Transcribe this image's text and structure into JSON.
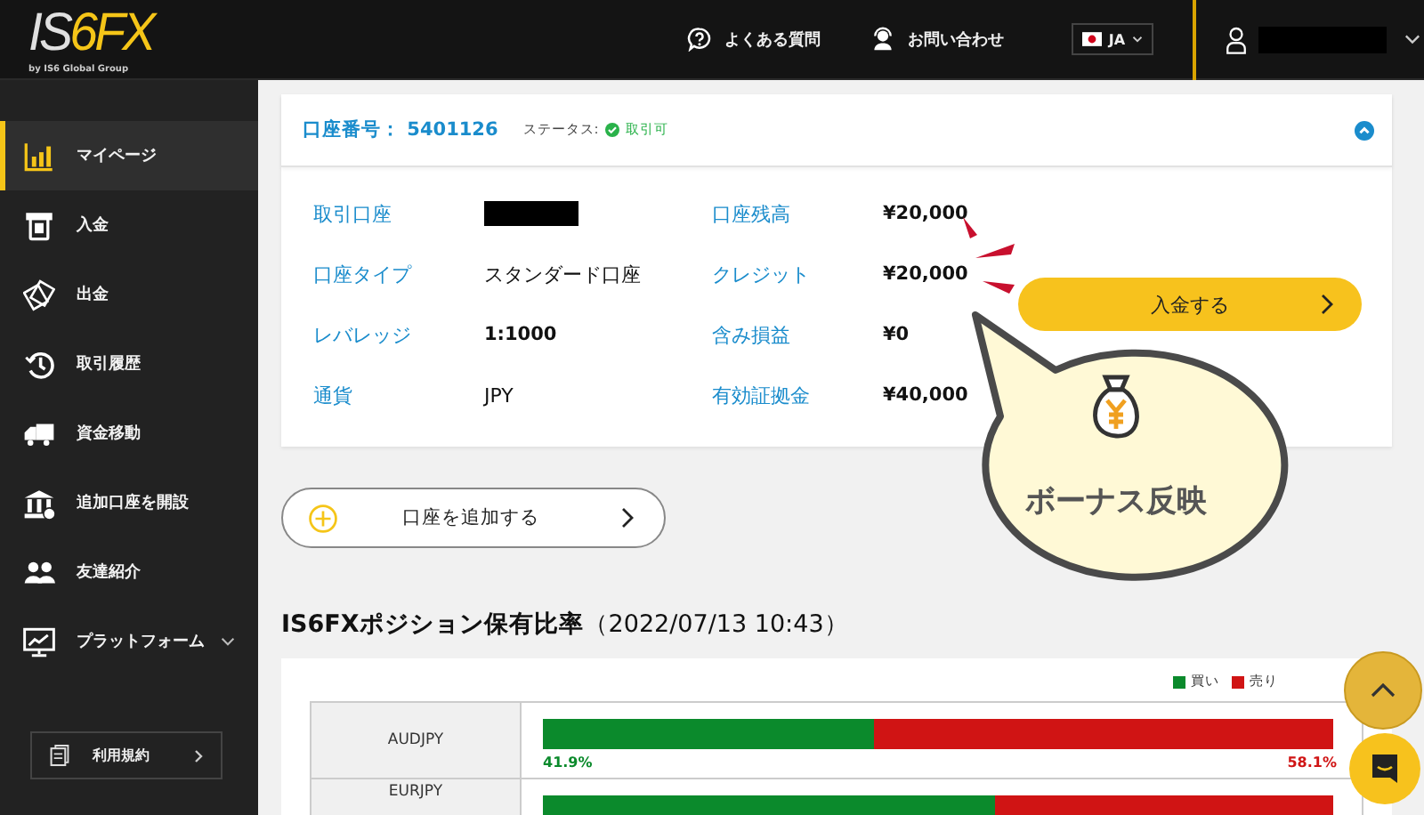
{
  "header": {
    "logo_main": "IS",
    "logo_accent": "6FX",
    "logo_tagline": "by IS6 Global Group",
    "links": [
      {
        "kind": "help",
        "label": "よくある質問"
      },
      {
        "kind": "contact",
        "label": "お問い合わせ"
      }
    ],
    "language": "JA"
  },
  "sidebar": {
    "items": [
      {
        "kind": "chart",
        "label": "マイページ",
        "selected": true,
        "expandable": false
      },
      {
        "kind": "deposit",
        "label": "入金",
        "selected": false,
        "expandable": false
      },
      {
        "kind": "withdraw",
        "label": "出金",
        "selected": false,
        "expandable": false
      },
      {
        "kind": "history",
        "label": "取引履歴",
        "selected": false,
        "expandable": false
      },
      {
        "kind": "transfer",
        "label": "資金移動",
        "selected": false,
        "expandable": false
      },
      {
        "kind": "bank",
        "label": "追加口座を開設",
        "selected": false,
        "expandable": false
      },
      {
        "kind": "friends",
        "label": "友達紹介",
        "selected": false,
        "expandable": false
      },
      {
        "kind": "monitor",
        "label": "プラットフォーム",
        "selected": false,
        "expandable": true
      }
    ],
    "terms_button": "利用規約"
  },
  "account": {
    "number_label": "口座番号：",
    "number": "5401126",
    "status_label": "ステータス:",
    "status": "取引可",
    "expanded": true,
    "fields": [
      {
        "label": "取引口座",
        "kind": "redacted"
      },
      {
        "label": "口座残高",
        "kind": "bold",
        "value": "¥20,000"
      },
      {
        "label": "口座タイプ",
        "kind": "text",
        "value": "スタンダード口座"
      },
      {
        "label": "クレジット",
        "kind": "bold",
        "value": "¥20,000"
      },
      {
        "label": "レバレッジ",
        "kind": "bold",
        "value": "1:1000"
      },
      {
        "label": "含み損益",
        "kind": "bold",
        "value": "¥0"
      },
      {
        "label": "通貨",
        "kind": "text",
        "value": "JPY"
      },
      {
        "label": "有効証拠金",
        "kind": "bold",
        "value": "¥40,000"
      }
    ],
    "deposit_button": "入金する"
  },
  "callout": "ボーナス反映",
  "add_account_button": "口座を追加する",
  "positions": {
    "title": "IS6FXポジション保有比率",
    "timestamp": "（2022/07/13 10:43）",
    "legend": [
      {
        "label": "買い",
        "color": "#0b8a2c"
      },
      {
        "label": "売り",
        "color": "#d01414"
      }
    ],
    "rows": [
      {
        "pair": "AUDJPY",
        "level": 0.419,
        "buy": "41.9%",
        "sell": "58.1%"
      },
      {
        "pair": "EURJPY",
        "level": 0.572
      }
    ]
  }
}
